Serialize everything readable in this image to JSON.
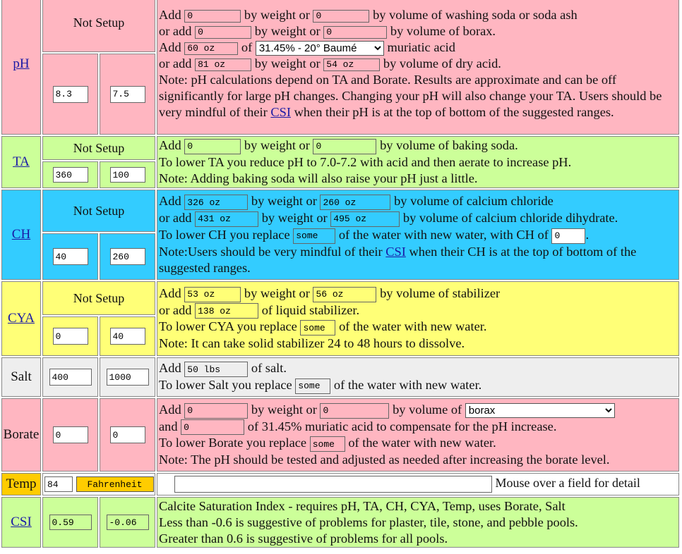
{
  "ph": {
    "label": "pH",
    "status": "Not Setup",
    "value_min": "8.3",
    "value_max": "7.5",
    "line1": {
      "add": "Add",
      "v1": "0",
      "by_weight_or": "by weight or",
      "v2": "0",
      "tail": "by volume of washing soda or soda ash"
    },
    "line2": {
      "or_add": "or add",
      "v1": "0",
      "by_weight_or": "by weight or",
      "v2": "0",
      "tail": "by volume of borax."
    },
    "line3": {
      "add": "Add",
      "v1": "60 oz",
      "of": "of",
      "acid_select": "31.45% - 20° Baumé",
      "tail": "muriatic acid"
    },
    "line4": {
      "or_add": "or add",
      "v1": "81 oz",
      "by_weight_or": "by weight or",
      "v2": "54 oz",
      "tail": "by volume of dry acid."
    },
    "note_a": "Note: pH calculations depend on TA and Borate. Results are approximate and can be off significantly for large pH changes. Changing your pH will also change your TA. Users should be very mindful of their",
    "note_link": "CSI",
    "note_b": "when their pH is at the top of bottom of the suggested ranges."
  },
  "ta": {
    "label": "TA",
    "status": "Not Setup",
    "value_min": "360",
    "value_max": "100",
    "line1": {
      "add": "Add",
      "v1": "0",
      "by_weight_or": "by weight or",
      "v2": "0",
      "tail": "by volume of baking soda."
    },
    "line2": "To lower TA you reduce pH to 7.0-7.2 with acid and then aerate to increase pH.",
    "line3": "Note: Adding baking soda will also raise your pH just a little."
  },
  "ch": {
    "label": "CH",
    "status": "Not Setup",
    "value_min": "40",
    "value_max": "260",
    "line1": {
      "add": "Add",
      "v1": "326 oz",
      "by_weight_or": "by weight or",
      "v2": "260 oz",
      "tail": "by volume of calcium chloride"
    },
    "line2": {
      "or_add": "or add",
      "v1": "431 oz",
      "by_weight_or": "by weight or",
      "v2": "495 oz",
      "tail": "by volume of calcium chloride dihydrate."
    },
    "line3": {
      "pre": "To lower CH you replace",
      "some": "some",
      "mid": "of the water with new water, with CH of",
      "ch_of": "0",
      "end": "."
    },
    "note_a": "Note:Users should be very mindful of their",
    "note_link": "CSI",
    "note_b": "when their CH is at the top of bottom of the suggested ranges."
  },
  "cya": {
    "label": "CYA",
    "status": "Not Setup",
    "value_min": "0",
    "value_max": "40",
    "line1": {
      "add": "Add",
      "v1": "53 oz",
      "by_weight_or": "by weight or",
      "v2": "56 oz",
      "tail": "by volume of stabilizer"
    },
    "line2": {
      "or_add": "or add",
      "v1": "138 oz",
      "tail": "of liquid stabilizer."
    },
    "line3": {
      "pre": "To lower CYA you replace",
      "some": "some",
      "tail": "of the water with new water."
    },
    "line4": "Note: It can take solid stabilizer 24 to 48 hours to dissolve."
  },
  "salt": {
    "label": "Salt",
    "value_min": "400",
    "value_max": "1000",
    "line1": {
      "add": "Add",
      "v1": "50 lbs",
      "tail": "of salt."
    },
    "line2": {
      "pre": "To lower Salt you replace",
      "some": "some",
      "tail": "of the water with new water."
    }
  },
  "borate": {
    "label": "Borate",
    "value_min": "0",
    "value_max": "0",
    "line1": {
      "add": "Add",
      "v1": "0",
      "by_weight_or": "by weight or",
      "v2": "0",
      "by_volume_of": "by volume of",
      "source_select": "borax"
    },
    "line2": {
      "and": "and",
      "v1": "0",
      "tail": "of 31.45% muriatic acid to compensate for the pH increase."
    },
    "line3": {
      "pre": "To lower Borate you replace",
      "some": "some",
      "tail": "of the water with new water."
    },
    "line4": "Note: The pH should be tested and adjusted as needed after increasing the borate level."
  },
  "temp": {
    "label": "Temp",
    "value": "84",
    "unit_button": "Fahrenheit",
    "detail_value": "",
    "hint": "Mouse over a field for detail"
  },
  "csi": {
    "label": "CSI",
    "value_min": "0.59",
    "value_max": "-0.06",
    "line1": "Calcite Saturation Index - requires pH, TA, CH, CYA, Temp, uses Borate, Salt",
    "line2": "Less than -0.6 is suggestive of problems for plaster, tile, stone, and pebble pools.",
    "line3": "Greater than 0.6 is suggestive of problems for all pools."
  },
  "colors": {
    "ph": "#ffb6c1",
    "ta": "#ccff99",
    "ch": "#33ccff",
    "cya": "#ffff77",
    "salt": "#eeeeee",
    "borate": "#ffb6c1",
    "temp": "#ffcc00",
    "csi": "#ccff99"
  }
}
